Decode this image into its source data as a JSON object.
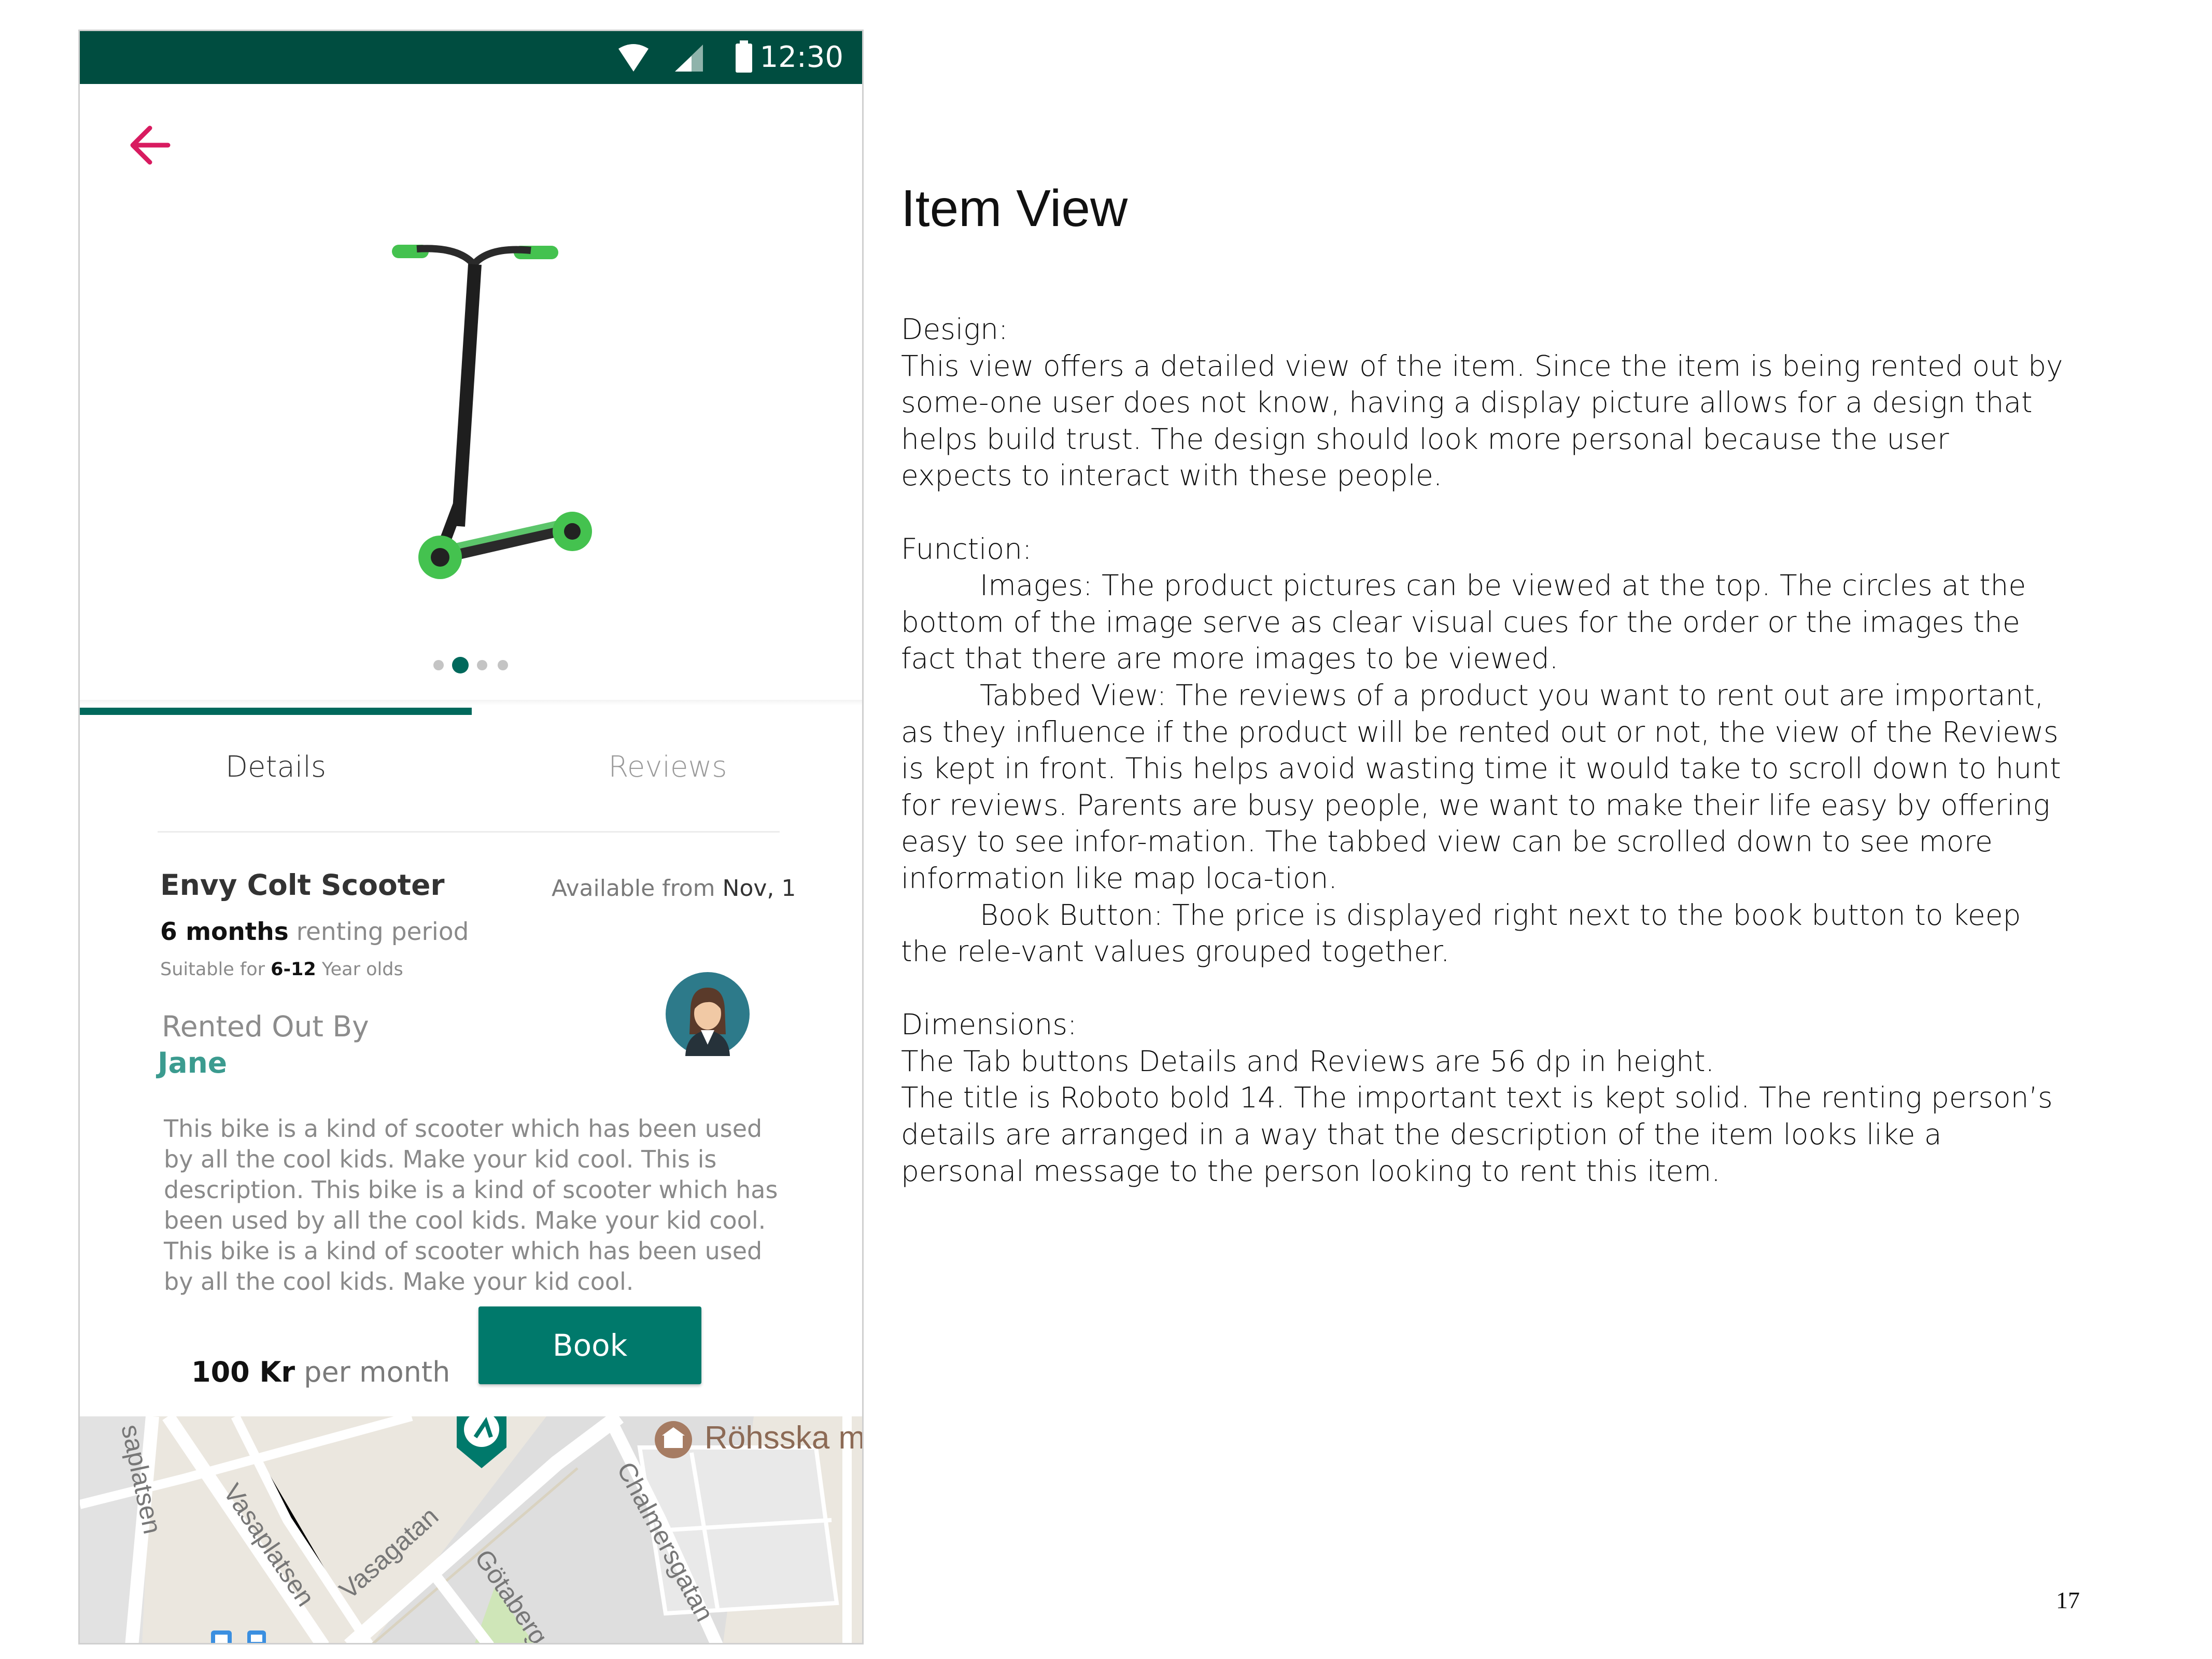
{
  "status_bar": {
    "time": "12:30"
  },
  "item": {
    "title": "Envy Colt Scooter",
    "available_label": "Available from",
    "available_date": "Nov, 1",
    "renting_duration": "6 months",
    "renting_label": "renting period",
    "suitable_prefix": "Suitable for",
    "age_range": "6-12",
    "suitable_suffix": "Year olds",
    "rented_by_label": "Rented Out By",
    "owner_name": "Jane",
    "description": "This bike is a kind of scooter which has been used by all the cool kids. Make your kid cool. This is description. This bike is a kind of scooter which has been used by all the cool kids. Make your kid cool. This bike is a kind of scooter which has been used by all the cool kids. Make your kid cool.",
    "price_amount": "100 Kr",
    "price_unit": "per month",
    "book_label": "Book"
  },
  "tabs": [
    {
      "label": "Details",
      "active": true
    },
    {
      "label": "Reviews",
      "active": false
    }
  ],
  "pager": {
    "count": 4,
    "active_index": 1
  },
  "map": {
    "street_labels": [
      "saplatsen",
      "Vasaplatsen",
      "Vasagatan",
      "Götaberg",
      "Chalmersgatan"
    ],
    "poi_label": "Röhsska mu"
  },
  "doc": {
    "title": "Item View",
    "design_heading": "Design:",
    "design_text": "This view offers a detailed view of the item. Since the item is being rented out by some-one user does not know, having a display picture allows for a design that helps build trust. The design should look more personal because the user expects to interact with these people.",
    "function_heading": "Function:",
    "function_images": "Images: The product pictures can be viewed at the top. The circles at the bottom of the image serve as clear visual cues for the order or the images the fact that there are more images to be viewed.",
    "function_tabbed": "Tabbed View: The reviews of a product you want to rent out are important, as they influence if the product will be rented out or not, the view of the Reviews is kept in front. This helps avoid wasting time it would take to scroll down to hunt for reviews. Parents are busy people, we want to make their life easy by offering easy to see infor-mation.  The tabbed view can be scrolled down to see more information like map loca-tion.",
    "function_book": "Book Button: The price is displayed right next to the book button to keep the rele-vant values grouped together.",
    "dimensions_heading": "Dimensions:",
    "dimensions_1": "The Tab buttons Details and Reviews are 56 dp in height.",
    "dimensions_2": "The title is Roboto bold 14. The important text is kept solid. The renting person’s details are arranged in a way that the description of the item looks like a personal message to the person looking to rent this item.",
    "page_number": "17"
  },
  "colors": {
    "status_bar": "#004d40",
    "accent": "#00796b",
    "back_arrow": "#d81b60",
    "owner_name": "#3b9b8f"
  }
}
